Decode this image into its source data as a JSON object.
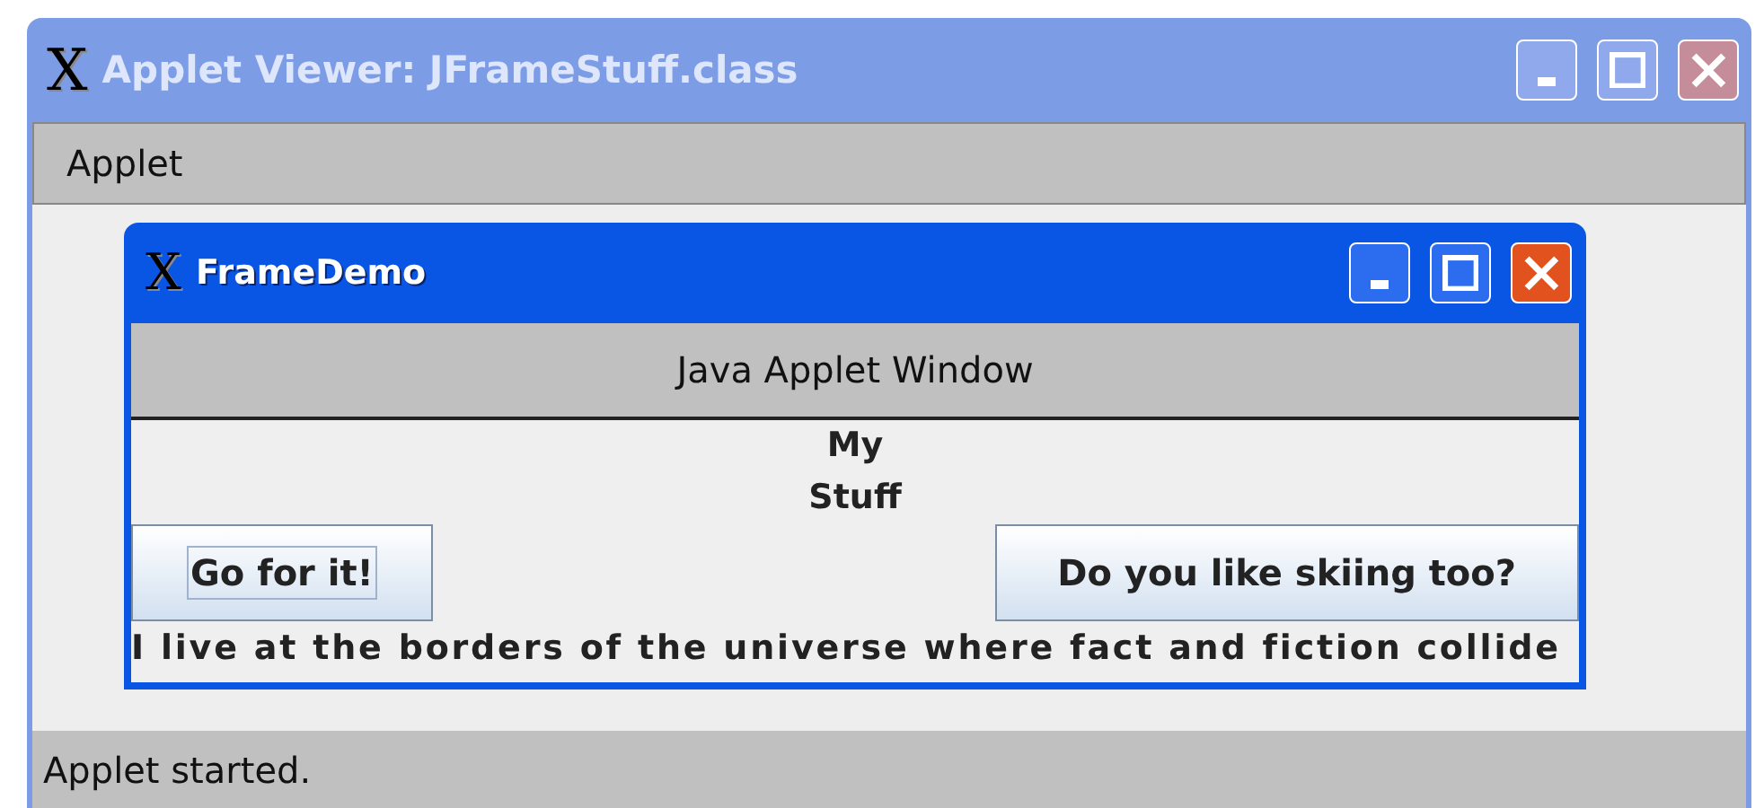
{
  "window": {
    "title": "Applet Viewer: JFrameStuff.class",
    "active": false,
    "logo": "X"
  },
  "menu_bar": {
    "items": [
      "Applet"
    ]
  },
  "frame": {
    "title": "FrameDemo",
    "active": true,
    "logo": "X",
    "header": "Java Applet Window",
    "labels": [
      "My",
      "Stuff"
    ],
    "buttons": [
      {
        "label": "Go for it!",
        "focused": true
      },
      {
        "label": "Do you like skiing too?",
        "focused": false
      }
    ],
    "footer_text": "I live at the borders of the universe where fact and fiction collide"
  },
  "status_bar": "Applet started."
}
